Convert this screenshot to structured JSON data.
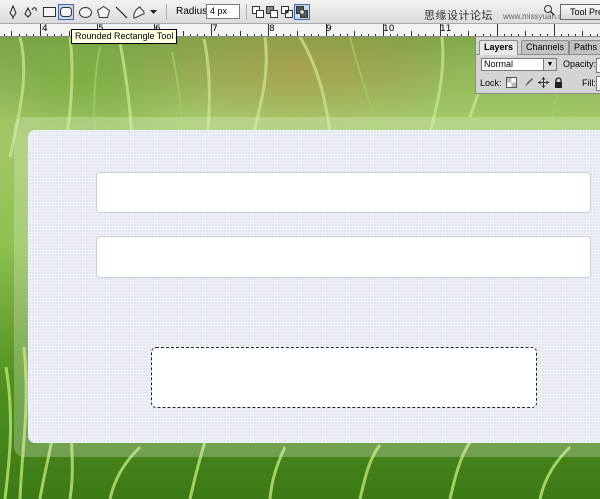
{
  "toolbar": {
    "tools": [
      {
        "icon": "pen-icon"
      },
      {
        "icon": "freeform-pen-icon"
      },
      {
        "icon": "rectangle-tool-icon"
      },
      {
        "icon": "rounded-rectangle-tool-icon",
        "active": true
      },
      {
        "icon": "ellipse-tool-icon"
      },
      {
        "icon": "polygon-tool-icon"
      },
      {
        "icon": "line-tool-icon"
      },
      {
        "icon": "custom-shape-tool-icon"
      }
    ],
    "radius_label": "Radius:",
    "radius_value": "4 px",
    "path_modes": [
      "add-to-path-icon",
      "subtract-from-path-icon",
      "intersect-path-icon",
      "exclude-path-icon"
    ],
    "watermark_text": "思缘设计论坛",
    "watermark_url": "www.missyuan.com",
    "tool_presets_label": "Tool Presets"
  },
  "ruler": {
    "numbers": [
      "4",
      "5",
      "6",
      "7",
      "8",
      "9",
      "10",
      "11"
    ]
  },
  "tooltip": "Rounded Rectangle Tool",
  "layers_palette": {
    "tabs": [
      {
        "label": "Layers",
        "active": true
      },
      {
        "label": "Channels",
        "active": false
      },
      {
        "label": "Paths",
        "active": false
      }
    ],
    "blend_mode": "Normal",
    "opacity_label": "Opacity:",
    "lock_label": "Lock:",
    "lock_icons": [
      "lock-transparent-icon",
      "lock-image-icon",
      "lock-position-icon",
      "lock-all-icon"
    ],
    "fill_label": "Fill:"
  },
  "canvas": {
    "panel_color": "#e2e6ee",
    "field_color": "#ffffff"
  }
}
